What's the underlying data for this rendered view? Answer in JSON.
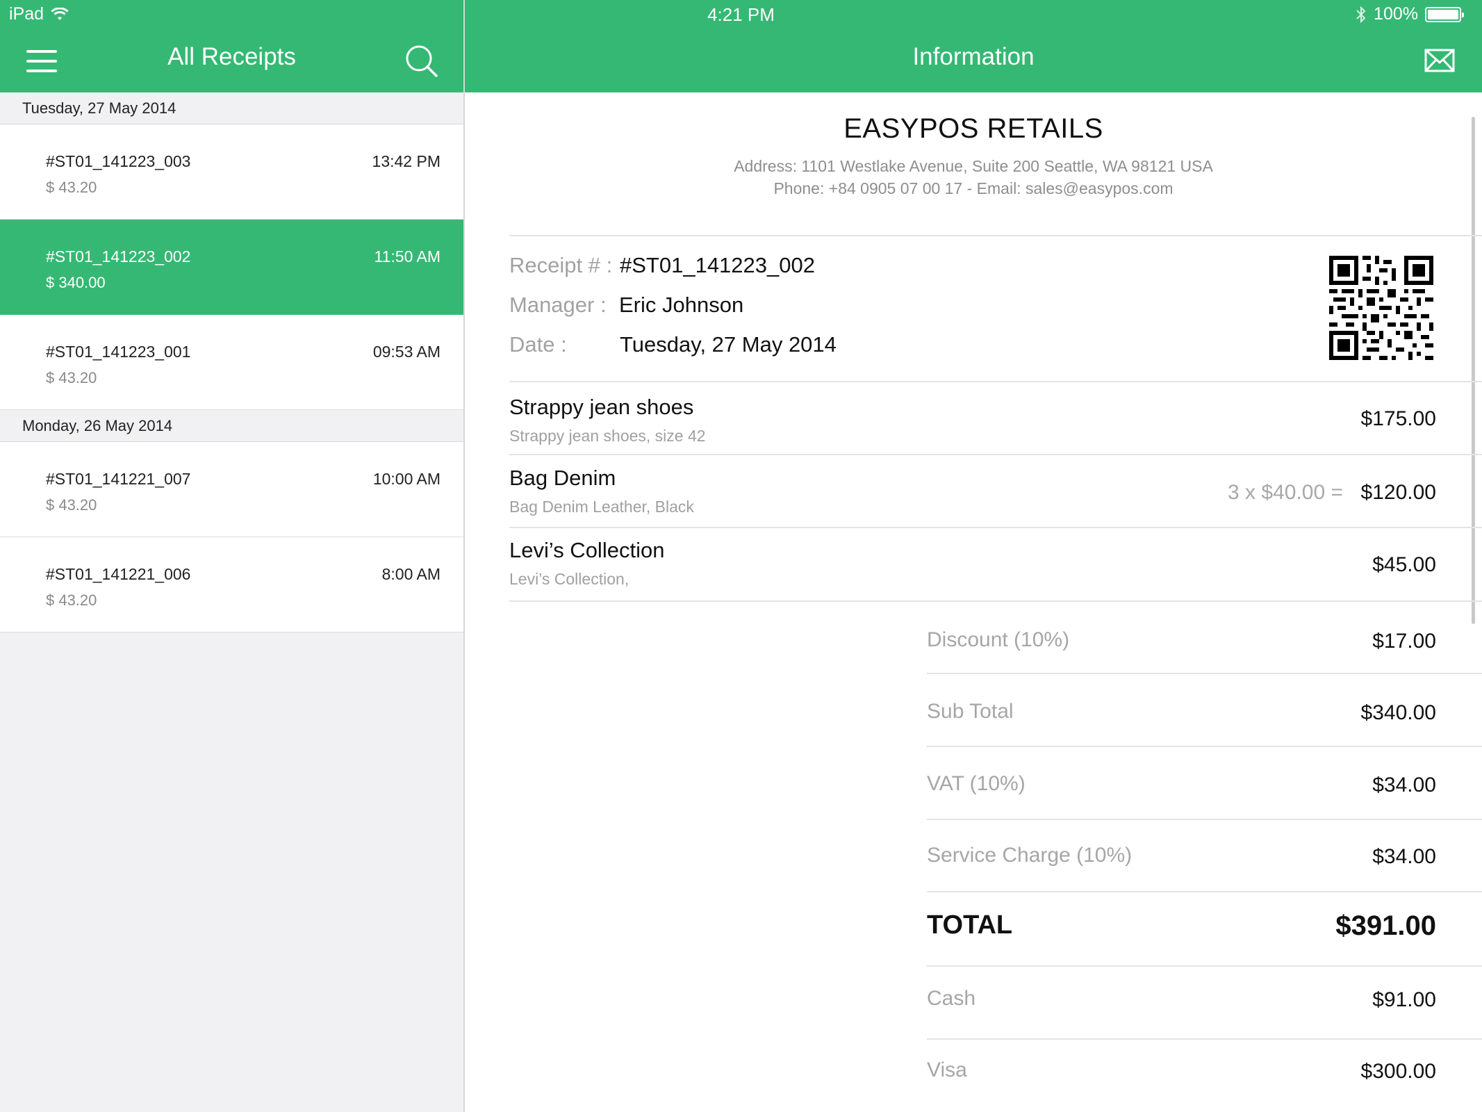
{
  "status_bar": {
    "device": "iPad",
    "time": "4:21 PM",
    "battery": "100%"
  },
  "nav": {
    "left_title": "All Receipts",
    "right_title": "Information"
  },
  "receipt_groups": [
    {
      "date": "Tuesday, 27 May 2014",
      "items": [
        {
          "id": "#ST01_141223_003",
          "time": "13:42 PM",
          "amount": "$ 43.20"
        },
        {
          "id": "#ST01_141223_002",
          "time": "11:50 AM",
          "amount": "$ 340.00"
        },
        {
          "id": "#ST01_141223_001",
          "time": "09:53 AM",
          "amount": "$ 43.20"
        }
      ]
    },
    {
      "date": "Monday, 26 May 2014",
      "items": [
        {
          "id": "#ST01_141221_007",
          "time": "10:00 AM",
          "amount": "$ 43.20"
        },
        {
          "id": "#ST01_141221_006",
          "time": "8:00 AM",
          "amount": "$ 43.20"
        }
      ]
    }
  ],
  "store": {
    "name": "EASYPOS RETAILS",
    "address": "Address: 1101 Westlake Avenue, Suite 200 Seattle, WA 98121 USA",
    "contact": "Phone: +84 0905 07 00 17  -  Email: sales@easypos.com"
  },
  "receipt": {
    "receipt_label": "Receipt # :",
    "receipt_no": "#ST01_141223_002",
    "manager_label": "Manager :",
    "manager": "Eric Johnson",
    "date_label": "Date :",
    "date": "Tuesday, 27 May 2014"
  },
  "line_items": [
    {
      "name": "Strappy jean shoes",
      "desc": "Strappy jean shoes, size 42",
      "qty": "",
      "price": "$175.00"
    },
    {
      "name": "Bag Denim",
      "desc": "Bag Denim Leather, Black",
      "qty": "3 x $40.00 =",
      "price": "$120.00"
    },
    {
      "name": "Levi’s Collection",
      "desc": "Levi’s Collection,",
      "qty": "",
      "price": "$45.00"
    }
  ],
  "summary": {
    "discount_label": "Discount (10%)",
    "discount": "$17.00",
    "subtotal_label": "Sub Total",
    "subtotal": "$340.00",
    "vat_label": "VAT (10%)",
    "vat": "$34.00",
    "service_label": "Service Charge (10%)",
    "service": "$34.00",
    "total_label": "TOTAL",
    "total": "$391.00",
    "cash_label": "Cash",
    "cash": "$91.00",
    "visa_label": "Visa",
    "visa": "$300.00"
  },
  "colors": {
    "accent": "#35b874",
    "panel_bg": "#f1f1f3"
  }
}
